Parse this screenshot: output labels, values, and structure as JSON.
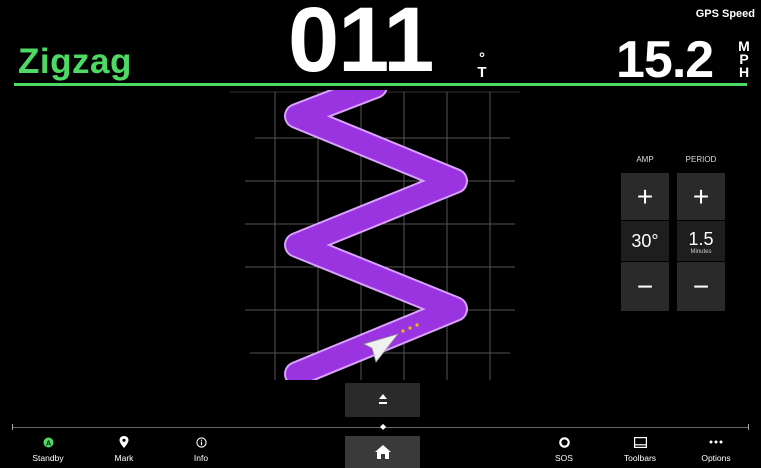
{
  "header": {
    "mode_title": "Zigzag",
    "heading_value": "011",
    "heading_unit_top": "°",
    "heading_unit_bottom": "T",
    "speed_label": "GPS Speed",
    "speed_value": "15.2",
    "speed_unit": [
      "M",
      "P",
      "H"
    ]
  },
  "panel": {
    "amp": {
      "label": "AMP",
      "value": "30°",
      "plus": "+",
      "minus": "−"
    },
    "period": {
      "label": "PERIOD",
      "value": "1.5",
      "unit": "Minutes",
      "plus": "+",
      "minus": "−"
    }
  },
  "nav": {
    "standby": "Standby",
    "mark": "Mark",
    "info": "Info",
    "sos": "SOS",
    "toolbars": "Toolbars",
    "options": "Options"
  },
  "colors": {
    "accent": "#4cd964",
    "track": "#9a33e0",
    "track_edge": "#d9a2ff"
  }
}
